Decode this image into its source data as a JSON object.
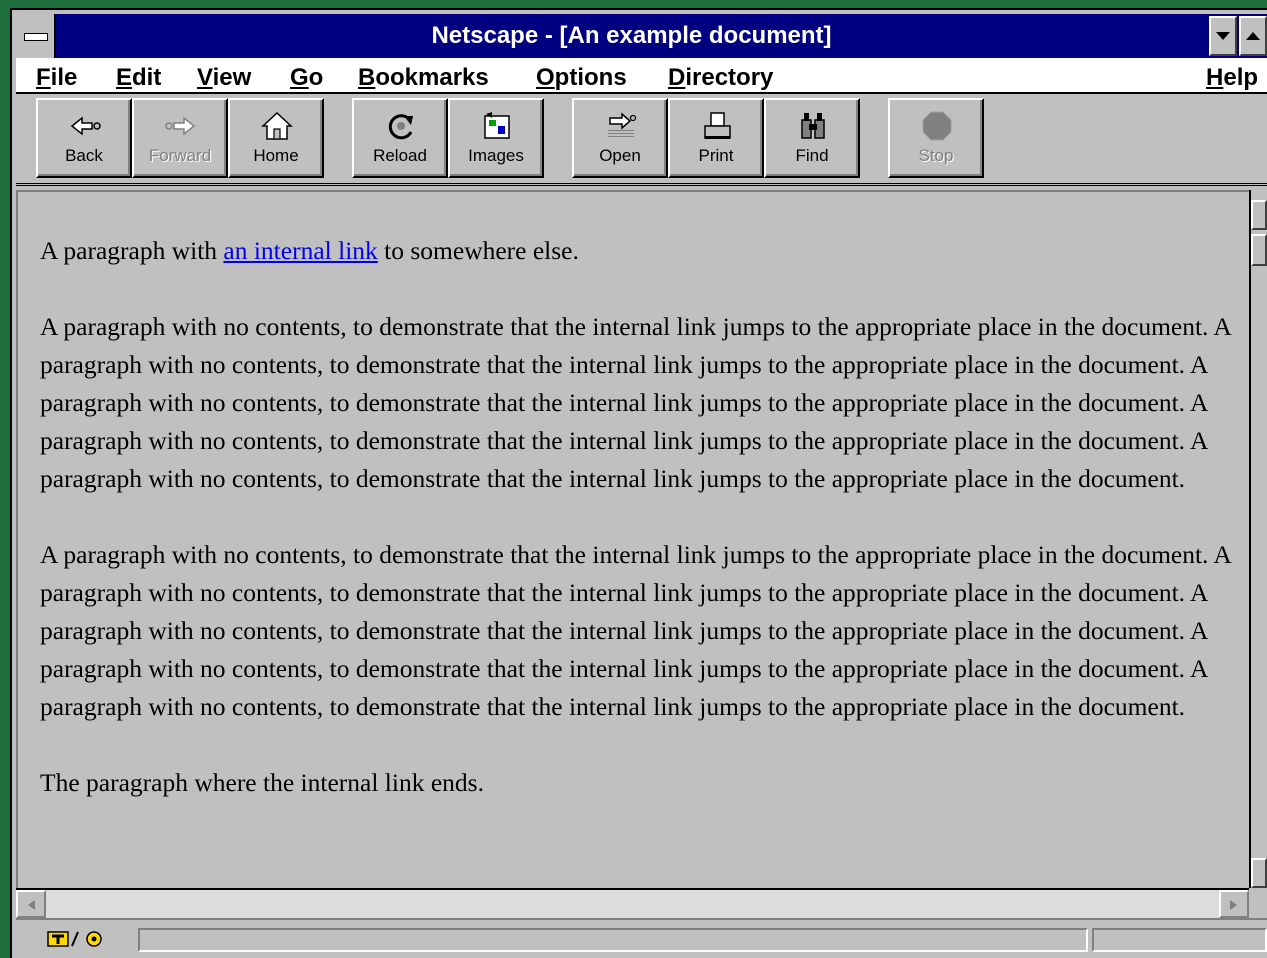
{
  "window": {
    "title": "Netscape - [An example document]"
  },
  "menubar": {
    "items": [
      "File",
      "Edit",
      "View",
      "Go",
      "Bookmarks",
      "Options",
      "Directory",
      "Help"
    ]
  },
  "toolbar": {
    "buttons": [
      {
        "label": "Back",
        "icon": "back-arrow-icon",
        "enabled": true
      },
      {
        "label": "Forward",
        "icon": "forward-arrow-icon",
        "enabled": false
      },
      {
        "label": "Home",
        "icon": "home-icon",
        "enabled": true
      },
      {
        "label": "Reload",
        "icon": "reload-icon",
        "enabled": true
      },
      {
        "label": "Images",
        "icon": "images-icon",
        "enabled": true
      },
      {
        "label": "Open",
        "icon": "open-icon",
        "enabled": true
      },
      {
        "label": "Print",
        "icon": "print-icon",
        "enabled": true
      },
      {
        "label": "Find",
        "icon": "find-icon",
        "enabled": true
      },
      {
        "label": "Stop",
        "icon": "stop-icon",
        "enabled": false
      }
    ]
  },
  "document": {
    "p1_before": "A paragraph with ",
    "p1_link": "an internal link",
    "p1_after": " to somewhere else.",
    "p2": "A paragraph with no contents, to demonstrate that the internal link jumps to the appropriate place in the document. A paragraph with no contents, to demonstrate that the internal link jumps to the appropriate place in the document. A paragraph with no contents, to demonstrate that the internal link jumps to the appropriate place in the document. A paragraph with no contents, to demonstrate that the internal link jumps to the appropriate place in the document. A paragraph with no contents, to demonstrate that the internal link jumps to the appropriate place in the document.",
    "p3": "A paragraph with no contents, to demonstrate that the internal link jumps to the appropriate place in the document. A paragraph with no contents, to demonstrate that the internal link jumps to the appropriate place in the document. A paragraph with no contents, to demonstrate that the internal link jumps to the appropriate place in the document. A paragraph with no contents, to demonstrate that the internal link jumps to the appropriate place in the document. A paragraph with no contents, to demonstrate that the internal link jumps to the appropriate place in the document.",
    "p4": "The paragraph where the internal link ends."
  },
  "statusbar": {
    "security_icon": "broken-key-icon",
    "message": ""
  },
  "colors": {
    "titlebar": "#000080",
    "desktop": "#1e6e3c",
    "link": "#0000ee",
    "chrome": "#c0c0c0"
  }
}
